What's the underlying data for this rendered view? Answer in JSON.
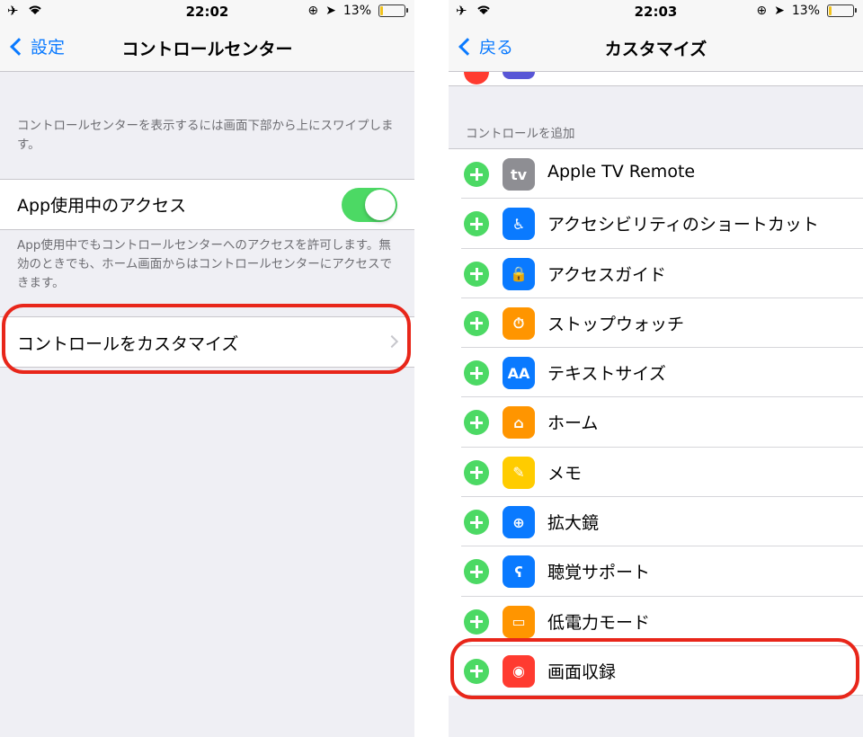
{
  "left": {
    "status": {
      "time": "22:02",
      "battery": "13%"
    },
    "nav": {
      "back_label": "設定",
      "title": "コントロールセンター"
    },
    "desc1": "コントロールセンターを表示するには画面下部から上にスワイプします。",
    "toggle_row": {
      "label": "App使用中のアクセス",
      "on": true
    },
    "desc2": "App使用中でもコントロールセンターへのアクセスを許可します。無効のときでも、ホーム画面からはコントロールセンターにアクセスできます。",
    "customize_row": {
      "label": "コントロールをカスタマイズ"
    }
  },
  "right": {
    "status": {
      "time": "22:03",
      "battery": "13%"
    },
    "nav": {
      "back_label": "戻る",
      "title": "カスタマイズ"
    },
    "section_header": "コントロールを追加",
    "items": [
      {
        "label": "Apple TV Remote",
        "icon": "apple-tv-icon",
        "icon_text": "tv",
        "color": "#8e8e93"
      },
      {
        "label": "アクセシビリティのショートカット",
        "icon": "accessibility-icon",
        "icon_text": "♿",
        "color": "#0a7aff"
      },
      {
        "label": "アクセスガイド",
        "icon": "lock-icon",
        "icon_text": "🔒",
        "color": "#0a7aff"
      },
      {
        "label": "ストップウォッチ",
        "icon": "stopwatch-icon",
        "icon_text": "⏱",
        "color": "#ff9500"
      },
      {
        "label": "テキストサイズ",
        "icon": "text-size-icon",
        "icon_text": "AA",
        "color": "#0a7aff"
      },
      {
        "label": "ホーム",
        "icon": "home-icon",
        "icon_text": "⌂",
        "color": "#ff9500"
      },
      {
        "label": "メモ",
        "icon": "notes-icon",
        "icon_text": "✎",
        "color": "#ffcc00"
      },
      {
        "label": "拡大鏡",
        "icon": "magnifier-icon",
        "icon_text": "⊕",
        "color": "#0a7aff"
      },
      {
        "label": "聴覚サポート",
        "icon": "ear-icon",
        "icon_text": "ʕ",
        "color": "#0a7aff"
      },
      {
        "label": "低電力モード",
        "icon": "battery-icon",
        "icon_text": "▭",
        "color": "#ff9500"
      },
      {
        "label": "画面収録",
        "icon": "screen-record-icon",
        "icon_text": "◉",
        "color": "#ff3b30"
      }
    ]
  },
  "colors": {
    "accent": "#0a7aff",
    "switch_on": "#4cd964",
    "highlight": "#e8261a"
  }
}
